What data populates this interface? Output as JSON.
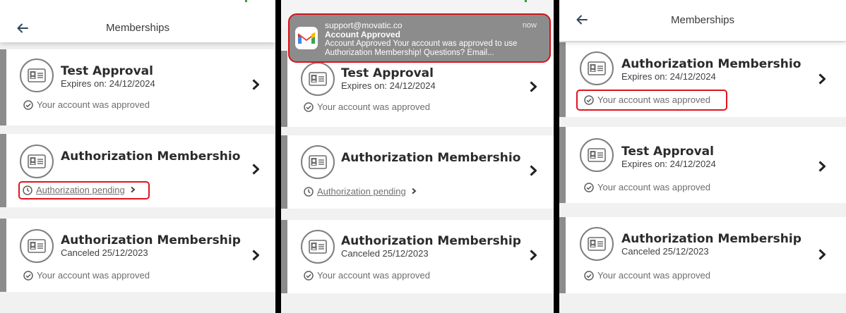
{
  "screens": [
    {
      "header_title": "Memberships",
      "cards": [
        {
          "name": "Test Approval",
          "sub": "Expires on: 24/12/2024",
          "status": "Your account was approved"
        },
        {
          "name": "Authorization Membershio",
          "status": "Authorization pending"
        },
        {
          "name": "Authorization Membership",
          "sub": "Canceled 25/12/2023",
          "status": "Your account was approved"
        }
      ]
    },
    {
      "notification": {
        "app_icon": "gmail-icon",
        "sender": "support@movatic.co",
        "time": "now",
        "title": "Account Approved",
        "body": "Account Approved Your account was approved to use Authorization Membership! Questions? Email..."
      },
      "cards": [
        {
          "name": "Test Approval",
          "sub": "Expires on: 24/12/2024",
          "status": "Your account was approved"
        },
        {
          "name": "Authorization Membershio",
          "status": "Authorization pending"
        },
        {
          "name": "Authorization Membership",
          "sub": "Canceled 25/12/2023",
          "status": "Your account was approved"
        }
      ]
    },
    {
      "header_title": "Memberships",
      "cards": [
        {
          "name": "Authorization Membershio",
          "sub": "Expires on: 24/12/2024",
          "status": "Your account was approved"
        },
        {
          "name": "Test Approval",
          "sub": "Expires on: 24/12/2024",
          "status": "Your account was approved"
        },
        {
          "name": "Authorization Membership",
          "sub": "Canceled 25/12/2023",
          "status": "Your account was approved"
        }
      ]
    }
  ],
  "colors": {
    "highlight": "#e0141e",
    "card_accent": "#8c8c8c",
    "background": "#f1f1f1",
    "notification_bg": "#8c8c8c"
  },
  "icons": [
    "back-arrow-icon",
    "id-card-icon",
    "check-circle-icon",
    "clock-icon",
    "chevron-right-icon",
    "gmail-icon"
  ]
}
